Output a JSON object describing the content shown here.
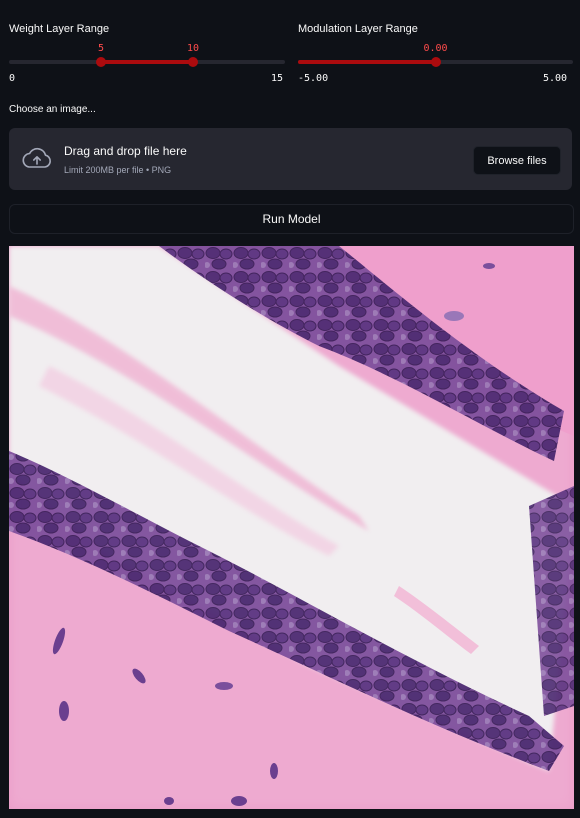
{
  "weight_slider": {
    "label": "Weight Layer Range",
    "min_label": "0",
    "max_label": "15",
    "low_label": "5",
    "high_label": "10",
    "min": 0,
    "max": 15,
    "low": 5,
    "high": 10
  },
  "modulation_slider": {
    "label": "Modulation Layer Range",
    "min_label": "-5.00",
    "max_label": "5.00",
    "value_label": "0.00",
    "min": -5,
    "max": 5,
    "value": 0
  },
  "uploader": {
    "label": "Choose an image...",
    "title": "Drag and drop file here",
    "subtitle": "Limit 200MB per file • PNG",
    "button": "Browse files",
    "icon": "cloud-upload-icon"
  },
  "run_button": "Run Model",
  "colors": {
    "accent": "#ab0b0e",
    "accent_text": "#ff4b4b",
    "background": "#0e1117",
    "surface": "#262730"
  }
}
